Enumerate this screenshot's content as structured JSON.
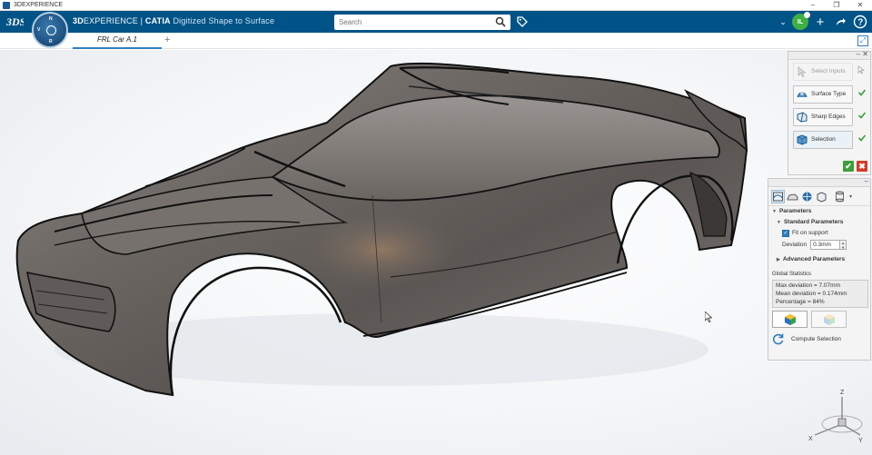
{
  "os": {
    "title": "3DEXPERIENCE"
  },
  "app": {
    "brand_prefix": "3D",
    "brand": "EXPERIENCE",
    "separator": " | ",
    "product": "CATIA",
    "module": "Digitized Shape to Surface"
  },
  "compass": {
    "n": "N",
    "v": "V",
    "r": "R"
  },
  "user": {
    "initials": "IL"
  },
  "search": {
    "placeholder": "Search",
    "value": ""
  },
  "tabs": [
    {
      "label": "FRL Car A.1"
    }
  ],
  "commands": [
    {
      "label": "Select Inputs",
      "state": "disabled",
      "icon": "select-inputs-icon"
    },
    {
      "label": "Surface Type",
      "state": "done",
      "icon": "surface-type-icon"
    },
    {
      "label": "Sharp Edges",
      "state": "done",
      "icon": "sharp-edges-icon"
    },
    {
      "label": "Selection",
      "state": "active",
      "icon": "selection-icon"
    }
  ],
  "parameters": {
    "title": "Parameters",
    "standard_title": "Standard Parameters",
    "fit_on_support_label": "Fit on support",
    "fit_on_support_checked": true,
    "deviation_label": "Deviation",
    "deviation_value": "0.3mm",
    "advanced_title": "Advanced Parameters"
  },
  "statistics": {
    "title": "Global Statistics",
    "max": "Max deviation = 7.07mm",
    "mean": "Mean deviation = 0.174mm",
    "percentage": "Percentage = 84%"
  },
  "compute": {
    "label": "Compute Selection"
  },
  "axis": {
    "x": "X",
    "y": "Y",
    "z": "Z"
  },
  "colors": {
    "topbar": "#005386",
    "accent": "#2d7fc1",
    "ok": "#3e9e3a",
    "cancel": "#d23b2a",
    "car_body": "#6f6a66"
  }
}
